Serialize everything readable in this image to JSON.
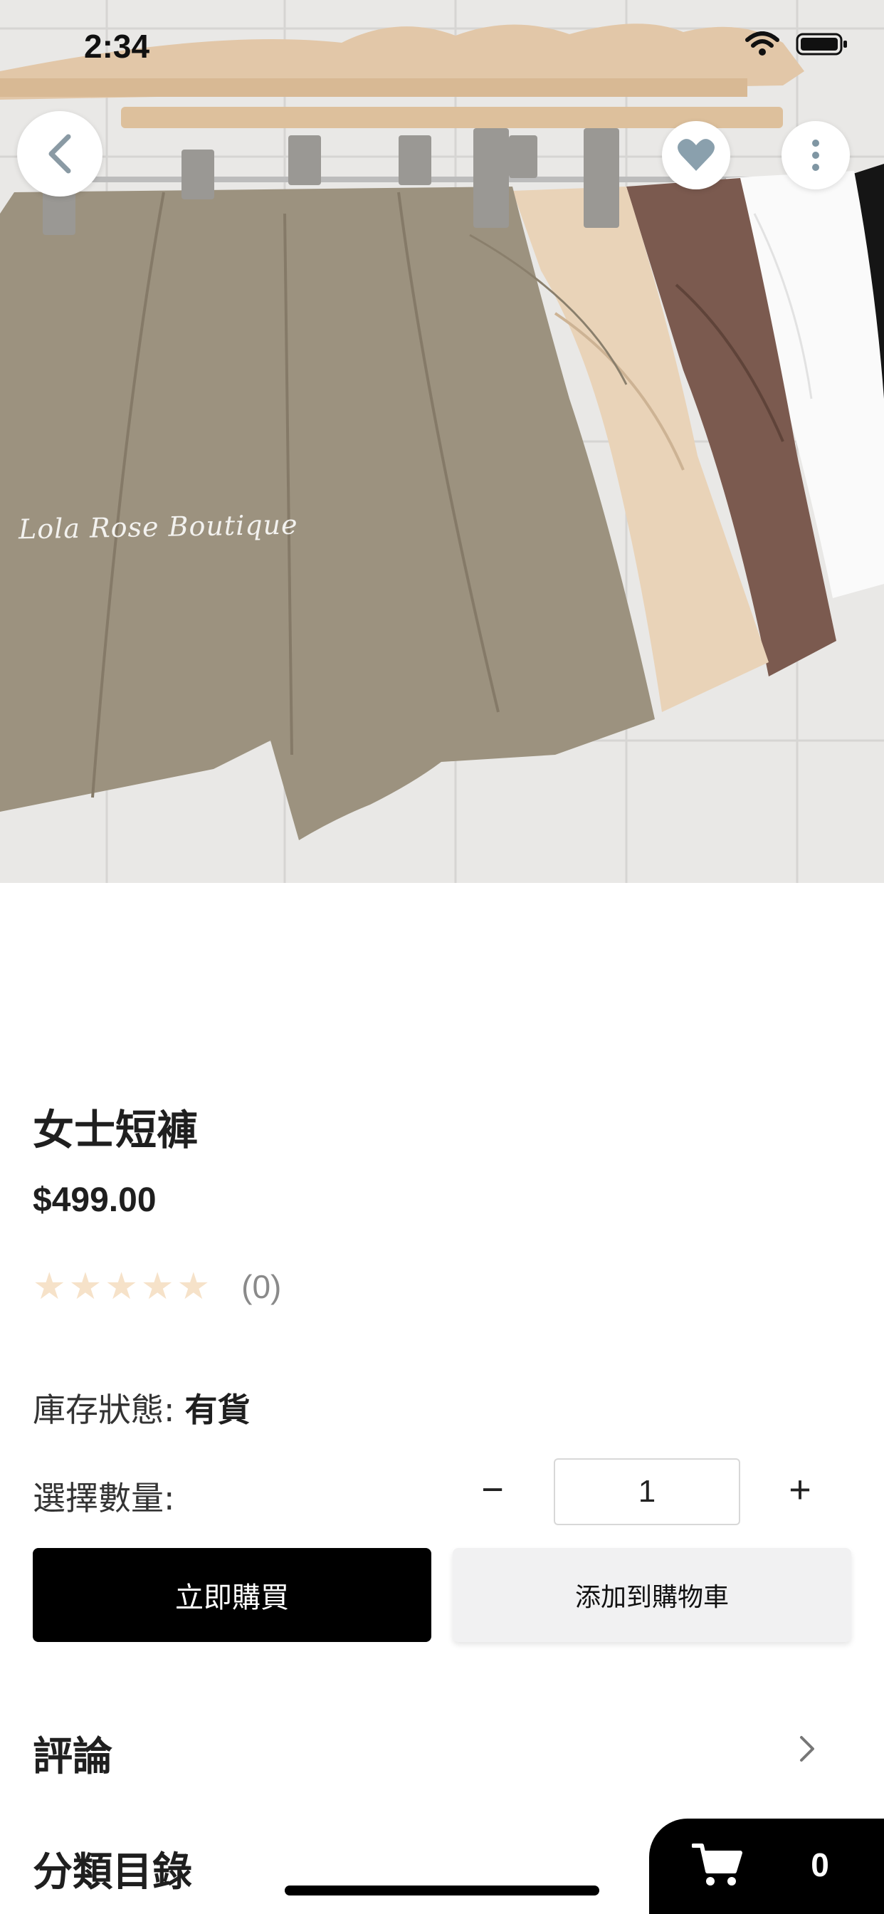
{
  "status_bar": {
    "time": "2:34"
  },
  "hero": {
    "watermark": "Lola Rose Boutique",
    "background_color": "#e9e8e6"
  },
  "nav": {
    "back_icon": "chevron-left-icon",
    "favorite_icon": "heart-icon",
    "favorite_color": "#8aa0ad",
    "more_icon": "more-vertical-icon"
  },
  "product": {
    "title": "女士短褲",
    "price": "$499.00",
    "rating": {
      "stars": 0,
      "max": 5,
      "count_label": "(0)",
      "star_color": "#f6e2c9"
    },
    "stock": {
      "label": "庫存狀態:",
      "value": "有貨"
    },
    "quantity": {
      "label": "選擇數量:",
      "minus": "−",
      "value": "1",
      "plus": "+"
    }
  },
  "actions": {
    "buy_now": "立即購買",
    "add_to_cart": "添加到購物車"
  },
  "sections": {
    "reviews": "評論",
    "categories": "分類目錄"
  },
  "cart": {
    "icon": "cart-icon",
    "count": "0"
  }
}
